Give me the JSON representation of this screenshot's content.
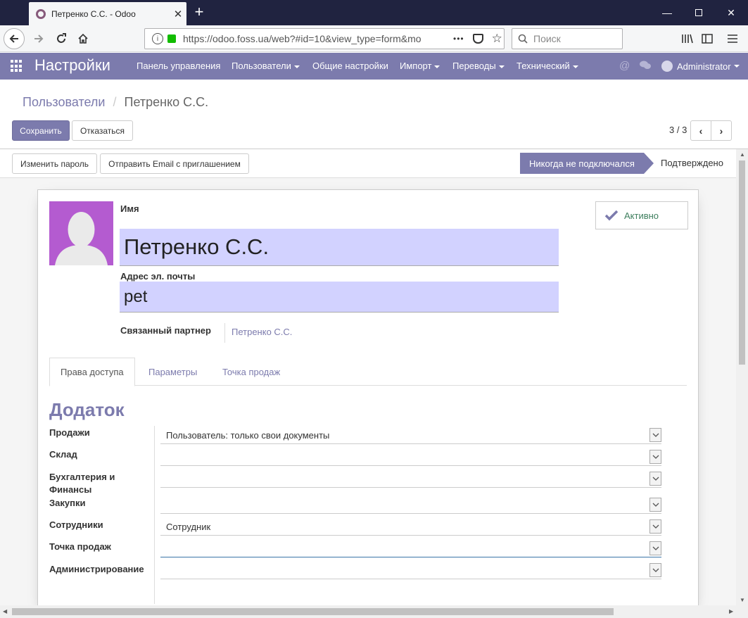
{
  "browser": {
    "tab_title": "Петренко С.С. - Odoo",
    "url": "https://odoo.foss.ua/web?#id=10&view_type=form&mo",
    "url_more": "•••",
    "search_placeholder": "Поиск"
  },
  "odoo": {
    "brand": "Настройки",
    "menu": [
      "Панель управления",
      "Пользователи",
      "Общие настройки",
      "Импорт",
      "Переводы",
      "Технический"
    ],
    "user": "Administrator"
  },
  "breadcrumb": {
    "parent": "Пользователи",
    "separator": "/",
    "current": "Петренко С.С."
  },
  "buttons": {
    "save": "Сохранить",
    "discard": "Отказаться",
    "change_password": "Изменить пароль",
    "send_invite": "Отправить Email с приглашением"
  },
  "pager": {
    "value": "3 / 3"
  },
  "status": {
    "active": "Никогда не подключался",
    "next": "Подтверждено"
  },
  "form": {
    "name_label": "Имя",
    "name_value": "Петренко С.С.",
    "email_label": "Адрес эл. почты",
    "email_value": "pet",
    "partner_label": "Связанный партнер",
    "partner_value": "Петренко С.С.",
    "active_label": "Активно"
  },
  "tabs": [
    "Права доступа",
    "Параметры",
    "Точка продаж"
  ],
  "section_title": "Додаток",
  "access_rights": [
    {
      "label": "Продажи",
      "value": "Пользователь: только свои документы"
    },
    {
      "label": "Склад",
      "value": ""
    },
    {
      "label": "Бухгалтерия и Финансы",
      "value": ""
    },
    {
      "label": "Закупки",
      "value": ""
    },
    {
      "label": "Сотрудники",
      "value": "Сотрудник"
    },
    {
      "label": "Точка продаж",
      "value": ""
    },
    {
      "label": "Администрирование",
      "value": ""
    }
  ],
  "colors": {
    "brand": "#7c7bad",
    "input_required": "#d2d2ff",
    "avatar_bg": "#b45bd0"
  }
}
